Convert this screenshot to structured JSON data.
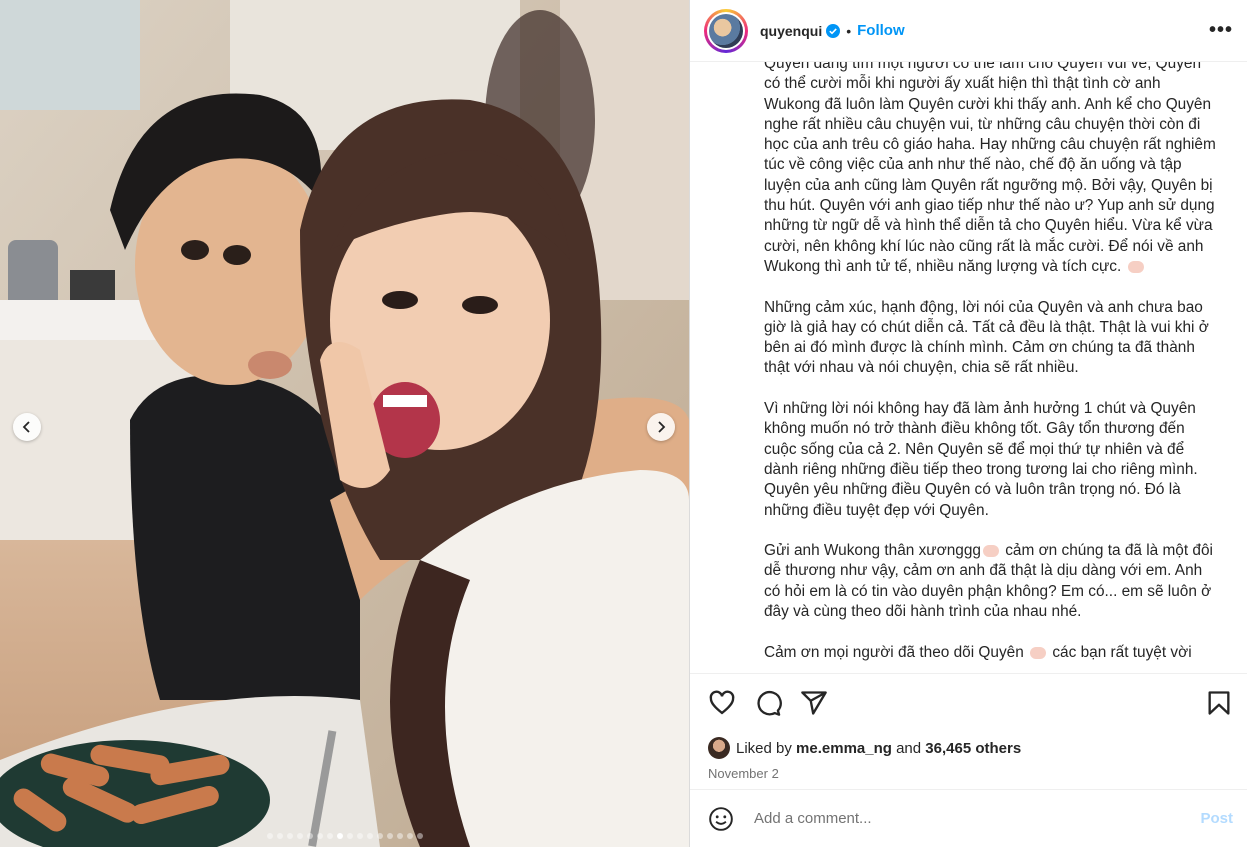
{
  "post": {
    "username": "quyenqui",
    "follow_label": "Follow",
    "more_label": "•••",
    "carousel": {
      "slide_count": 16,
      "active_index": 7
    }
  },
  "caption": {
    "paragraphs": [
      "Quyên đang tìm một người có thể làm cho Quyên vui vẻ, Quyên có thể cười mỗi khi người ấy xuất hiện thì thật tình cờ anh Wukong đã luôn làm Quyên cười khi thấy anh. Anh kể cho Quyên nghe rất nhiều câu chuyện vui, từ những câu chuyện thời còn đi học của anh trêu cô giáo haha. Hay những câu chuyện rất nghiêm túc về công việc của anh như thế nào, chế độ ăn uống và tập luyện của anh cũng làm Quyên rất ngưỡng mộ. Bởi vậy, Quyên bị thu hút. Quyên với anh giao tiếp như thế nào ư? Yup anh sử dụng những từ ngữ dễ và hình thể diễn tả cho Quyên hiểu. Vừa kể vừa cười, nên không khí lúc nào cũng rất là mắc cười. Để nói về anh Wukong thì anh tử tế, nhiều năng lượng và tích cực.",
      "Những cảm xúc, hạnh động, lời nói của Quyên và anh chưa bao giờ là giả hay có chút diễn cả. Tất cả đều là thật. Thật là vui khi ở bên ai đó mình được là chính mình. Cảm ơn chúng ta đã thành thật với nhau và nói chuyện, chia sẽ rất nhiều.",
      "Vì những lời nói không hay đã làm ảnh hưởng 1 chút và Quyên không muốn nó trở thành điều không tốt. Gây tổn thương đến cuộc sống của cả 2. Nên Quyên sẽ để mọi thứ tự nhiên và để dành riêng những điều tiếp theo trong tương lai cho riêng mình. Quyên yêu những điều Quyên có và luôn trân trọng nó. Đó là những điều tuyệt đẹp với Quyên.",
      "Gửi anh Wukong thân xươnggg",
      "cảm ơn chúng ta đã là một đôi dễ thương như vậy, cảm ơn anh đã thật là dịu dàng với em. Anh có hỏi em là có tin vào duyên phận không? Em có... em sẽ luôn ở đây và cùng theo dõi hành trình của nhau nhé.",
      "Cảm ơn mọi người đã theo dõi Quyên",
      "các bạn rất tuyệt vời"
    ]
  },
  "engagement": {
    "liked_by_prefix": "Liked by",
    "liked_by_user": "me.emma_ng",
    "and_label": "and",
    "others_label": "36,465 others",
    "date": "November 2"
  },
  "comment_box": {
    "placeholder": "Add a comment...",
    "post_label": "Post"
  },
  "colors": {
    "accent": "#0095f6",
    "post_disabled": "#b3dbff",
    "muted": "#737373"
  },
  "icons": [
    "verified-badge-icon",
    "more-options-icon",
    "chevron-left-icon",
    "chevron-right-icon",
    "heart-icon",
    "comment-icon",
    "share-icon",
    "bookmark-icon",
    "emoji-icon"
  ]
}
